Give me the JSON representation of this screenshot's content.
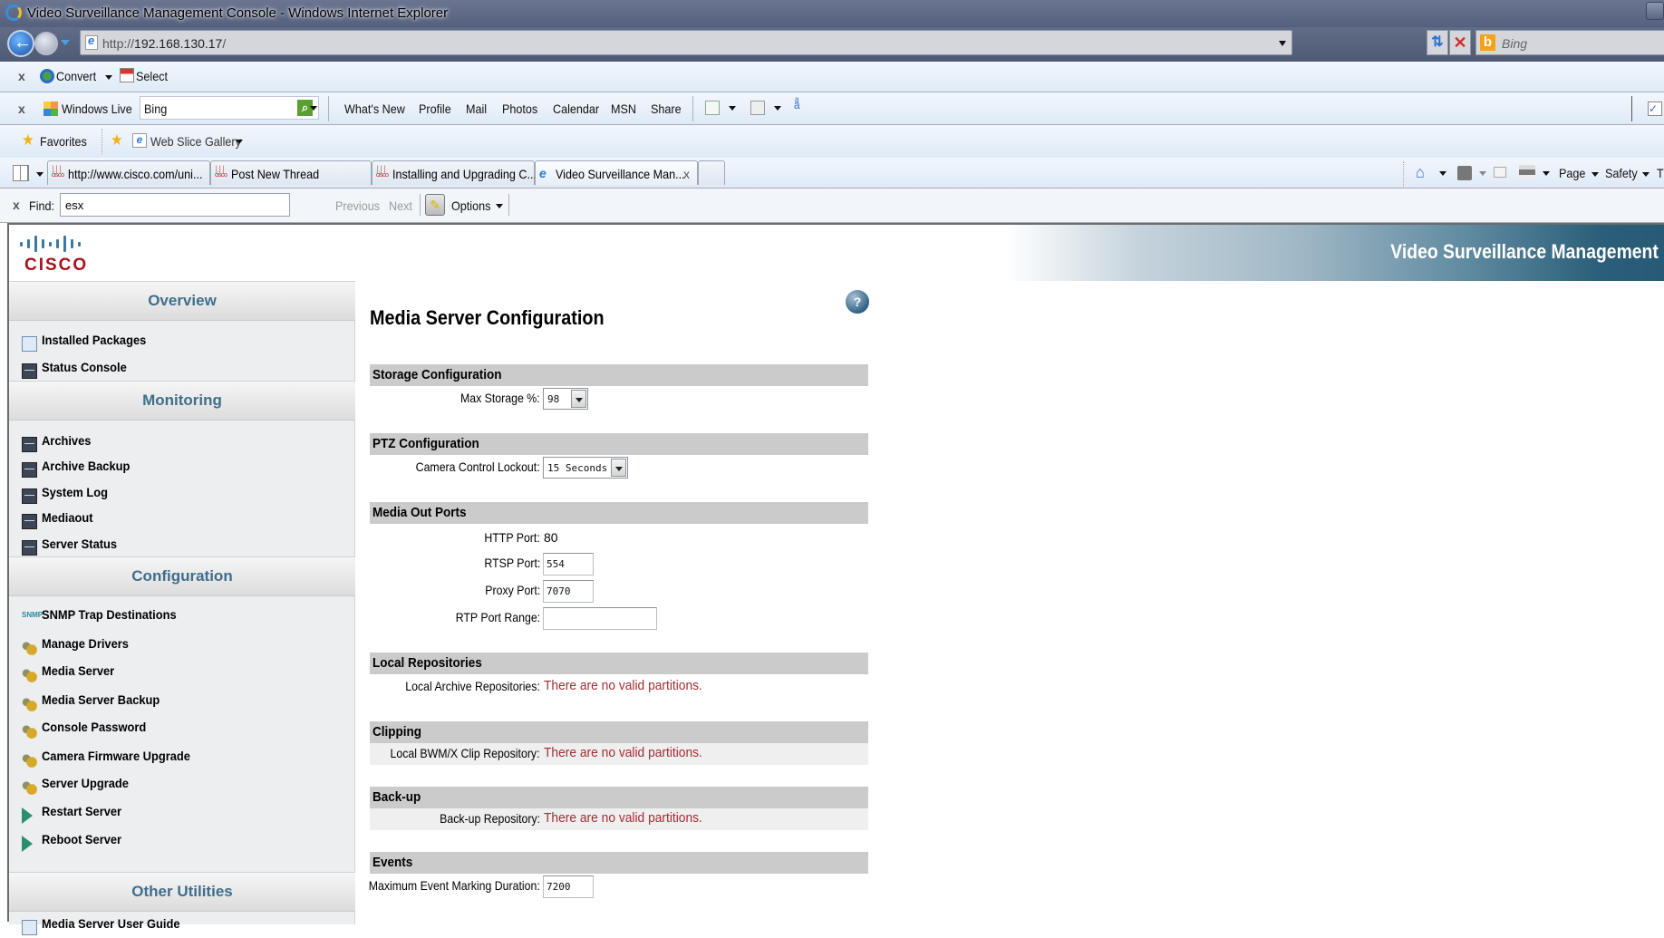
{
  "window": {
    "title": "Video Surveillance Management Console - Windows Internet Explorer"
  },
  "address_bar": {
    "url_prefix": "http://",
    "url_host": "192.168.130.17",
    "url_suffix": "/",
    "search_placeholder": "Bing"
  },
  "convert_toolbar": {
    "close": "x",
    "convert_label": "Convert",
    "select_label": "Select"
  },
  "live_toolbar": {
    "close": "x",
    "brand_label": "Windows Live",
    "search_value": "Bing",
    "links": [
      "What's New",
      "Profile",
      "Mail",
      "Photos",
      "Calendar",
      "MSN",
      "Share"
    ]
  },
  "favorites_bar": {
    "favorites_label": "Favorites",
    "web_slice_label": "Web Slice Gallery"
  },
  "tabs": [
    {
      "label": "http://www.cisco.com/uni...",
      "active": false
    },
    {
      "label": "Post New Thread",
      "active": false
    },
    {
      "label": "Installing and Upgrading C...",
      "active": false
    },
    {
      "label": "Video Surveillance Man...",
      "active": true,
      "close": "x"
    }
  ],
  "command_bar": {
    "page_label": "Page",
    "safety_label": "Safety",
    "tools_label": "T"
  },
  "find_bar": {
    "close": "x",
    "label": "Find:",
    "value": "esx",
    "previous_label": "Previous",
    "next_label": "Next",
    "options_label": "Options"
  },
  "header": {
    "logo_text": "CISCO",
    "banner_title": "Video Surveillance Management"
  },
  "sidebar": {
    "sections": [
      {
        "title": "Overview",
        "items": [
          {
            "label": "Installed Packages",
            "icon": "document-icon"
          },
          {
            "label": "Status Console",
            "icon": "monitor-icon"
          }
        ]
      },
      {
        "title": "Monitoring",
        "items": [
          {
            "label": "Archives",
            "icon": "monitor-icon"
          },
          {
            "label": "Archive Backup",
            "icon": "monitor-icon"
          },
          {
            "label": "System Log",
            "icon": "monitor-icon"
          },
          {
            "label": "Mediaout",
            "icon": "monitor-icon"
          },
          {
            "label": "Server Status",
            "icon": "monitor-icon"
          }
        ]
      },
      {
        "title": "Configuration",
        "items": [
          {
            "label": "SNMP Trap Destinations",
            "icon": "snmp-icon"
          },
          {
            "label": "Manage Drivers",
            "icon": "gears-icon"
          },
          {
            "label": "Media Server",
            "icon": "gears-icon"
          },
          {
            "label": "Media Server Backup",
            "icon": "gears-icon"
          },
          {
            "label": "Console Password",
            "icon": "gears-icon"
          },
          {
            "label": "Camera Firmware Upgrade",
            "icon": "gears-icon"
          },
          {
            "label": "Server Upgrade",
            "icon": "gears-icon"
          },
          {
            "label": "Restart Server",
            "icon": "play-icon"
          },
          {
            "label": "Reboot Server",
            "icon": "play-icon"
          }
        ]
      },
      {
        "title": "Other Utilities",
        "items": [
          {
            "label": "Media Server User Guide",
            "icon": "document-icon"
          }
        ]
      }
    ]
  },
  "main": {
    "title": "Media Server Configuration",
    "help": "?",
    "storage": {
      "heading": "Storage Configuration",
      "max_storage_label": "Max Storage %:",
      "max_storage_value": "98"
    },
    "ptz": {
      "heading": "PTZ Configuration",
      "lockout_label": "Camera Control Lockout:",
      "lockout_value": "15 Seconds"
    },
    "media_out": {
      "heading": "Media Out Ports",
      "http_label": "HTTP Port:",
      "http_value": "80",
      "rtsp_label": "RTSP Port:",
      "rtsp_value": "554",
      "proxy_label": "Proxy Port:",
      "proxy_value": "7070",
      "rtp_label": "RTP Port Range:",
      "rtp_value": ""
    },
    "local_repositories": {
      "heading": "Local Repositories",
      "label": "Local Archive Repositories:",
      "message": "There are no valid partitions."
    },
    "clipping": {
      "heading": "Clipping",
      "label": "Local BWM/X Clip Repository:",
      "message": "There are no valid partitions."
    },
    "backup": {
      "heading": "Back-up",
      "label": "Back-up Repository:",
      "message": "There are no valid partitions."
    },
    "events": {
      "heading": "Events",
      "label": "Maximum Event Marking Duration:",
      "value": "7200"
    }
  }
}
